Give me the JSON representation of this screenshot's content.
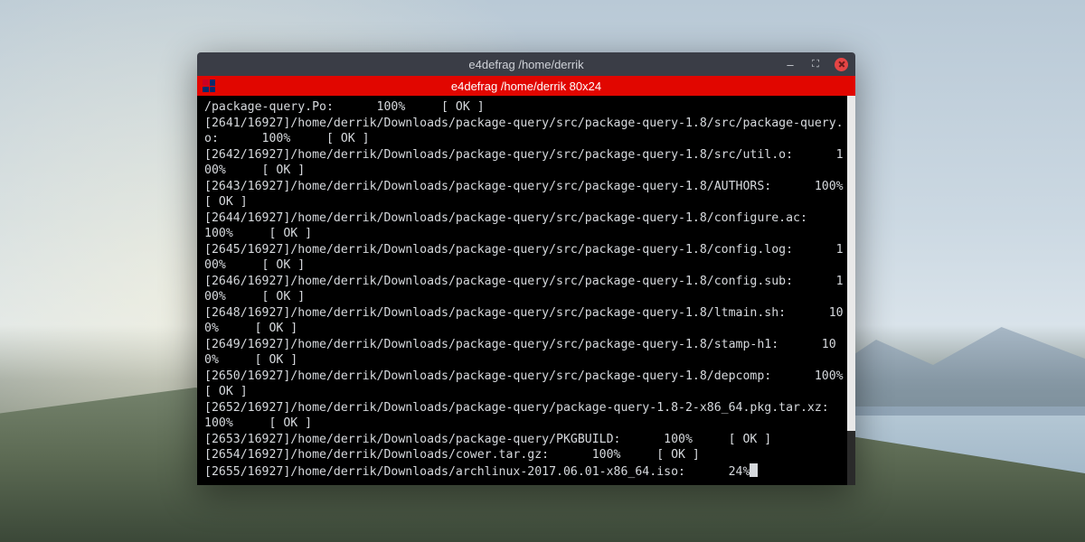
{
  "window": {
    "title": "e4defrag  /home/derrik",
    "tab_title": "e4defrag  /home/derrik 80x24"
  },
  "terminal": {
    "entries": [
      {
        "counter": "",
        "path": "/package-query.Po:",
        "pct": "100%",
        "status": "[ OK ]"
      },
      {
        "counter": "[2641/16927]",
        "path": "/home/derrik/Downloads/package-query/src/package-query-1.8/src/package-query.o:",
        "pct": "100%",
        "status": "[ OK ]"
      },
      {
        "counter": "[2642/16927]",
        "path": "/home/derrik/Downloads/package-query/src/package-query-1.8/src/util.o:",
        "pct": "100%",
        "status": "[ OK ]"
      },
      {
        "counter": "[2643/16927]",
        "path": "/home/derrik/Downloads/package-query/src/package-query-1.8/AUTHORS:",
        "pct": "100%",
        "status": "[ OK ]"
      },
      {
        "counter": "[2644/16927]",
        "path": "/home/derrik/Downloads/package-query/src/package-query-1.8/configure.ac:",
        "pct": "100%",
        "status": "[ OK ]"
      },
      {
        "counter": "[2645/16927]",
        "path": "/home/derrik/Downloads/package-query/src/package-query-1.8/config.log:",
        "pct": "100%",
        "status": "[ OK ]"
      },
      {
        "counter": "[2646/16927]",
        "path": "/home/derrik/Downloads/package-query/src/package-query-1.8/config.sub:",
        "pct": "100%",
        "status": "[ OK ]"
      },
      {
        "counter": "[2648/16927]",
        "path": "/home/derrik/Downloads/package-query/src/package-query-1.8/ltmain.sh:",
        "pct": "100%",
        "status": "[ OK ]"
      },
      {
        "counter": "[2649/16927]",
        "path": "/home/derrik/Downloads/package-query/src/package-query-1.8/stamp-h1:",
        "pct": "100%",
        "status": "[ OK ]"
      },
      {
        "counter": "[2650/16927]",
        "path": "/home/derrik/Downloads/package-query/src/package-query-1.8/depcomp:",
        "pct": "100%",
        "status": "[ OK ]"
      },
      {
        "counter": "[2652/16927]",
        "path": "/home/derrik/Downloads/package-query/package-query-1.8-2-x86_64.pkg.tar.xz:",
        "pct": "100%",
        "status": "[ OK ]"
      },
      {
        "counter": "[2653/16927]",
        "path": "/home/derrik/Downloads/package-query/PKGBUILD:",
        "pct": "100%",
        "status": "[ OK ]"
      },
      {
        "counter": "[2654/16927]",
        "path": "/home/derrik/Downloads/cower.tar.gz:",
        "pct": "100%",
        "status": "[ OK ]"
      },
      {
        "counter": "[2655/16927]",
        "path": "/home/derrik/Downloads/archlinux-2017.06.01-x86_64.iso:",
        "pct": "24%",
        "status": ""
      }
    ]
  }
}
